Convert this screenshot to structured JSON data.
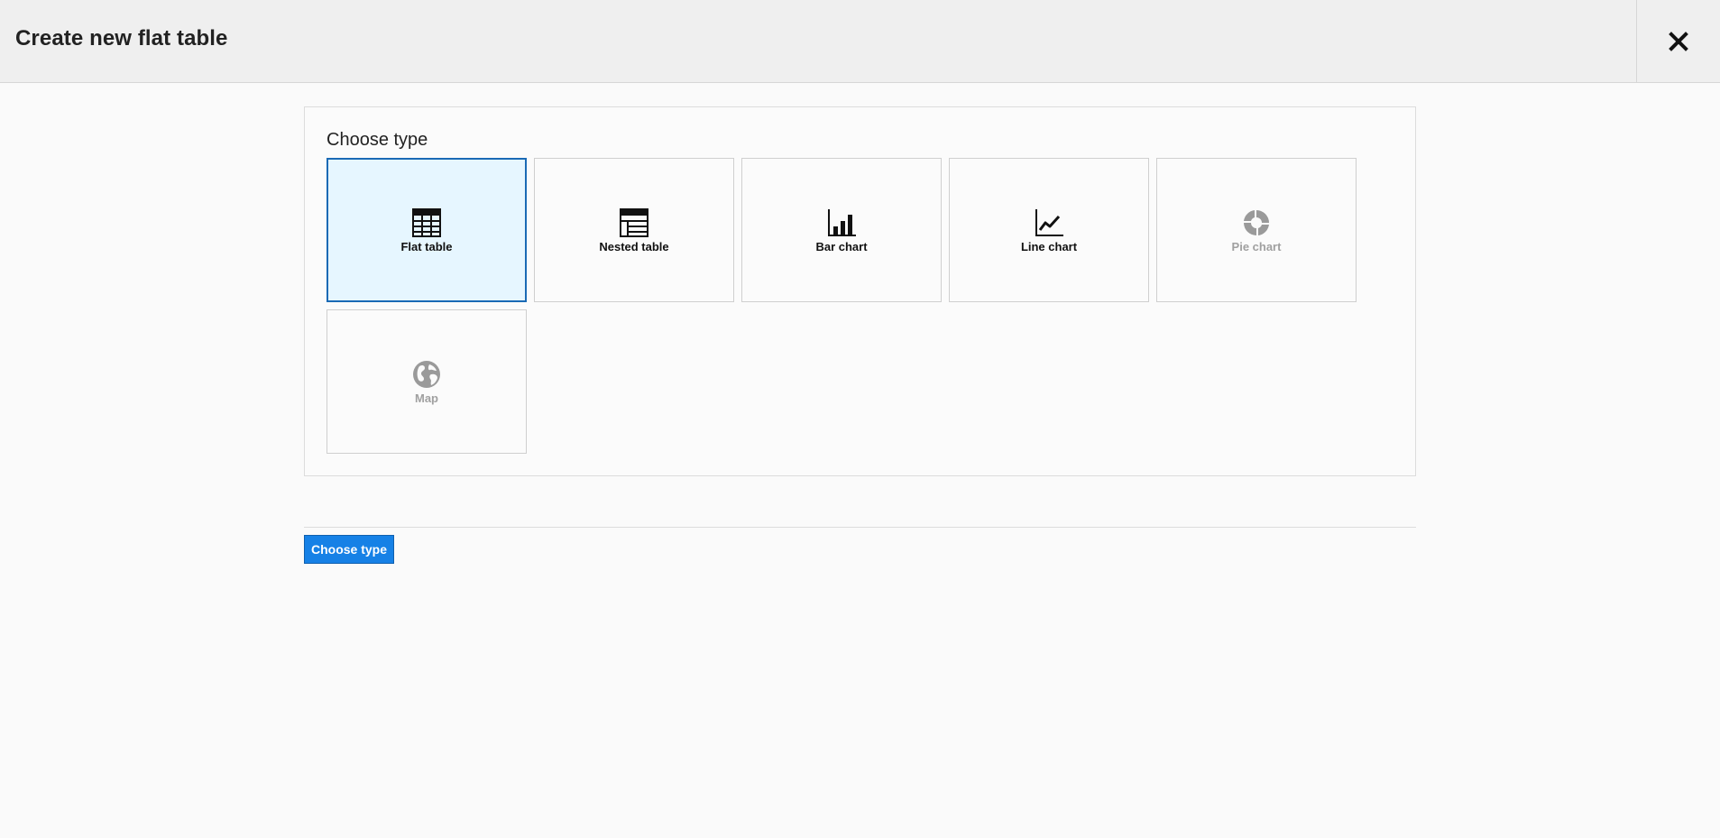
{
  "header": {
    "title": "Create new flat table",
    "close_icon": "close-icon"
  },
  "panel": {
    "title": "Choose type",
    "types": [
      {
        "label": "Flat table",
        "icon": "flat-table-icon",
        "selected": true,
        "enabled": true
      },
      {
        "label": "Nested table",
        "icon": "nested-table-icon",
        "selected": false,
        "enabled": true
      },
      {
        "label": "Bar chart",
        "icon": "bar-chart-icon",
        "selected": false,
        "enabled": true
      },
      {
        "label": "Line chart",
        "icon": "line-chart-icon",
        "selected": false,
        "enabled": true
      },
      {
        "label": "Pie chart",
        "icon": "pie-chart-icon",
        "selected": false,
        "enabled": false
      },
      {
        "label": "Map",
        "icon": "globe-icon",
        "selected": false,
        "enabled": false
      }
    ]
  },
  "footer": {
    "choose_button_label": "Choose type"
  },
  "colors": {
    "accent": "#1681e6",
    "selected_border": "#1a6ab5",
    "selected_background": "#e6f6ff",
    "disabled_text": "#a0a0a0"
  }
}
